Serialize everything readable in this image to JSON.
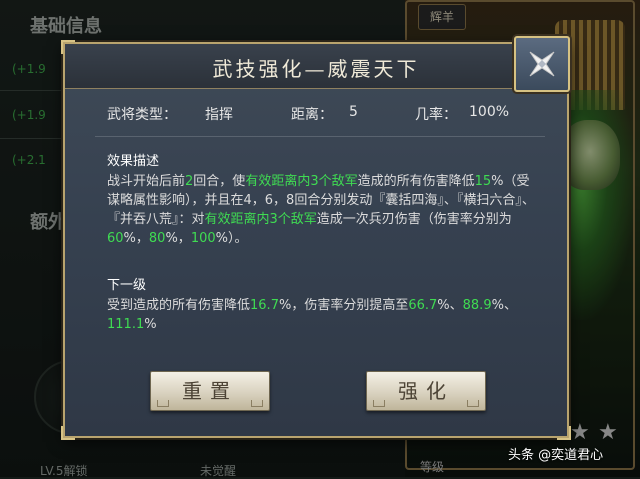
{
  "background": {
    "section_basic": "基础信息",
    "section_extra": "额外",
    "stats": [
      "(+1.9",
      "(+1.9",
      "(+2.1"
    ],
    "level_label": "LV.5解锁",
    "awaken_label": "未觉醒",
    "rank_label": "等级",
    "tag": "辉羊"
  },
  "dialog": {
    "title": "武技强化—威震天下",
    "general_type_label": "武将类型：",
    "general_type_value": "指挥",
    "range_label": "距离：",
    "range_value": "5",
    "chance_label": "几率：",
    "chance_value": "100%",
    "effect_heading": "效果描述",
    "effect_segments": [
      {
        "text": "战斗开始后前",
        "hl": false
      },
      {
        "text": "2",
        "hl": true
      },
      {
        "text": "回合，使",
        "hl": false
      },
      {
        "text": "有效距离内3个敌军",
        "hl": true
      },
      {
        "text": "造成的所有伤害降低",
        "hl": false
      },
      {
        "text": "15",
        "hl": true
      },
      {
        "text": "%（受谋略属性影响），并且在4，6，8回合分别发动『囊括四海』、『横扫六合』、『并吞八荒』：对",
        "hl": false
      },
      {
        "text": "有效距离内3个敌军",
        "hl": true
      },
      {
        "text": "造成一次兵刃伤害（伤害率分别为",
        "hl": false
      },
      {
        "text": "60",
        "hl": true
      },
      {
        "text": "%，",
        "hl": false
      },
      {
        "text": "80",
        "hl": true
      },
      {
        "text": "%，",
        "hl": false
      },
      {
        "text": "100",
        "hl": true
      },
      {
        "text": "%）。",
        "hl": false
      }
    ],
    "next_level_heading": "下一级",
    "next_level_segments": [
      {
        "text": "受到造成的所有伤害降低",
        "hl": false
      },
      {
        "text": "16.7",
        "hl": true
      },
      {
        "text": "%，伤害率分别提高至",
        "hl": false
      },
      {
        "text": "66.7",
        "hl": true
      },
      {
        "text": "%、",
        "hl": false
      },
      {
        "text": "88.9",
        "hl": true
      },
      {
        "text": "%、",
        "hl": false
      },
      {
        "text": "111.1",
        "hl": true
      },
      {
        "text": "%",
        "hl": false
      }
    ],
    "reset_button": "重置",
    "enhance_button": "强化"
  },
  "watermark": "头条 @奕道君心",
  "colors": {
    "highlight": "#3fdc52",
    "dialog_border": "#b9a46e",
    "button_text": "#4d4436"
  },
  "icons": {
    "close": "close-x-icon"
  }
}
